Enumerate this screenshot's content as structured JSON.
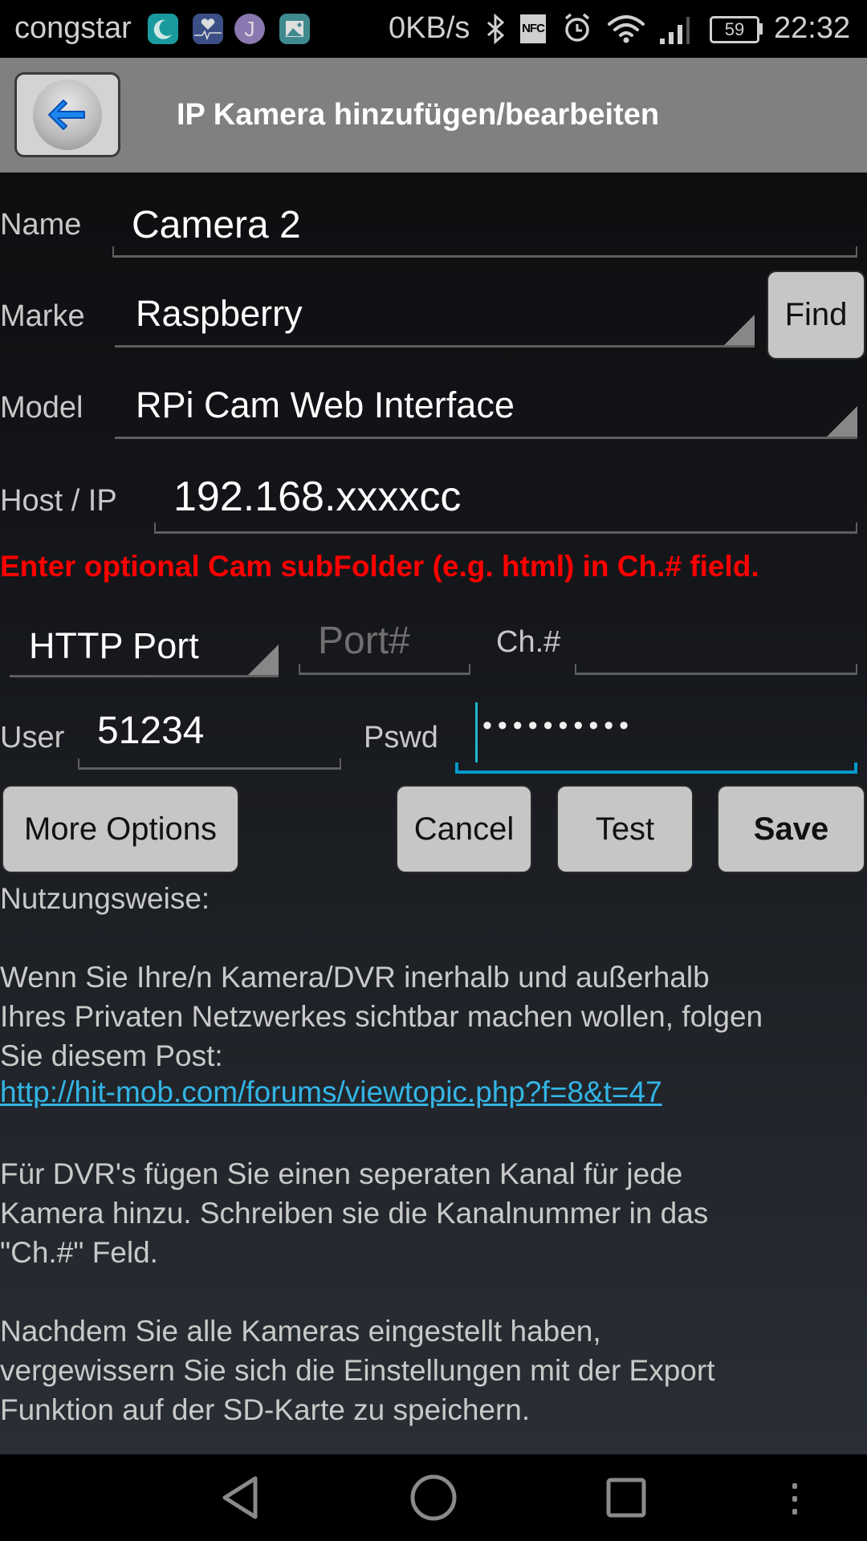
{
  "status_bar": {
    "carrier": "congstar",
    "notification_icons": [
      "moon-app-icon",
      "heart-monitor-icon",
      "j-app-icon",
      "gallery-icon"
    ],
    "net_speed": "0KB/s",
    "system_icons": [
      "bluetooth-icon",
      "nfc-icon",
      "alarm-icon",
      "wifi-icon",
      "signal-icon"
    ],
    "nfc_label": "NFC",
    "battery": "59",
    "time": "22:32"
  },
  "header": {
    "title": "IP Kamera hinzufügen/bearbeiten",
    "back_icon": "back-arrow-icon"
  },
  "form": {
    "name": {
      "label": "Name",
      "value": "Camera 2"
    },
    "brand": {
      "label": "Marke",
      "value": "Raspberry",
      "find_button": "Find"
    },
    "model": {
      "label": "Model",
      "value": "RPi Cam Web Interface"
    },
    "host": {
      "label": "Host / IP",
      "value": "192.168.xxxxcc"
    },
    "warning": "Enter optional Cam subFolder (e.g. html) in Ch.# field.",
    "port_type": {
      "value": "HTTP Port"
    },
    "port": {
      "placeholder": "Port#",
      "value": ""
    },
    "channel": {
      "label": "Ch.#",
      "value": ""
    },
    "user": {
      "label": "User",
      "value": "51234"
    },
    "password": {
      "label": "Pswd",
      "masked_value": "••••••••••",
      "length": 10
    }
  },
  "buttons": {
    "more_options": "More Options",
    "cancel": "Cancel",
    "test": "Test",
    "save": "Save"
  },
  "help": {
    "heading": "Nutzungsweise:",
    "para1": "Wenn Sie Ihre/n Kamera/DVR inerhalb und außerhalb\nIhres Privaten Netzwerkes sichtbar machen wollen, folgen\nSie diesem Post:",
    "link": "http://hit-mob.com/forums/viewtopic.php?f=8&t=47",
    "para2": "Für DVR's fügen Sie einen seperaten Kanal für jede\nKamera hinzu. Schreiben sie die Kanalnummer in das\n\"Ch.#\" Feld.",
    "para3": "Nachdem Sie alle Kameras eingestellt haben,\nvergewissern Sie sich die Einstellungen mit der Export\nFunktion auf der SD-Karte zu speichern."
  },
  "nav_bar": {
    "buttons": [
      "back-nav-icon",
      "home-nav-icon",
      "recents-nav-icon",
      "menu-nav-icon"
    ]
  },
  "colors": {
    "header_bg": "#808080",
    "warning": "#ff0000",
    "link": "#33b5e5",
    "focus_accent": "#0099cc",
    "button_bg": "#c6c6c6"
  }
}
